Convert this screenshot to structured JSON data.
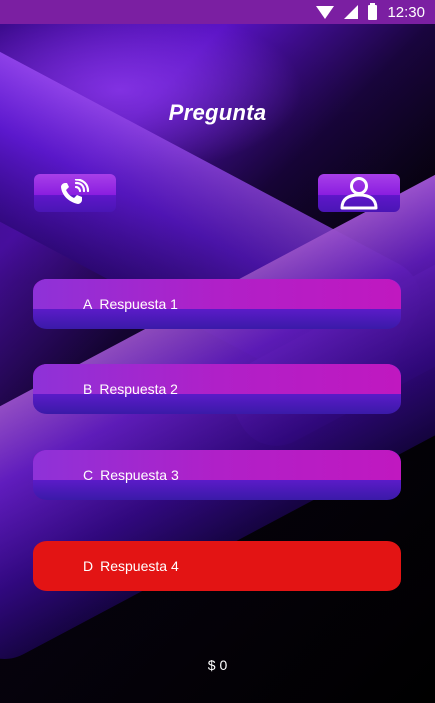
{
  "status_bar": {
    "time": "12:30",
    "icons": [
      "wifi-icon",
      "signal-icon",
      "battery-icon"
    ]
  },
  "question": {
    "title": "Pregunta"
  },
  "lifelines": [
    {
      "icon": "phone-call-icon",
      "name": "call"
    },
    {
      "icon": "person-icon",
      "name": "audience"
    }
  ],
  "answers": [
    {
      "letter": "A",
      "text": "Respuesta 1",
      "state": "default"
    },
    {
      "letter": "B",
      "text": "Respuesta 2",
      "state": "default"
    },
    {
      "letter": "C",
      "text": "Respuesta 3",
      "state": "default"
    },
    {
      "letter": "D",
      "text": "Respuesta 4",
      "state": "selected"
    }
  ],
  "score": {
    "text": "$ 0"
  },
  "colors": {
    "status_bar": "#7b1fa2",
    "answer_selected": "#e31414",
    "answer_default": "#9a1ed4"
  }
}
